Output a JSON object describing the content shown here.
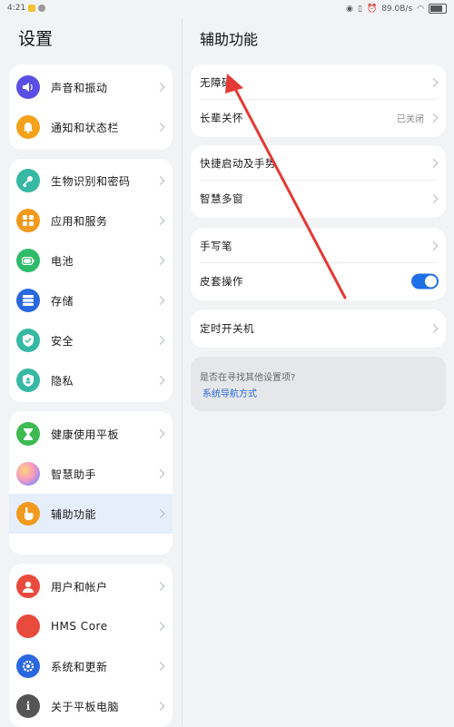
{
  "status_bar": {
    "time": "4:21",
    "speed": "89.0B/s",
    "battery": "89"
  },
  "left": {
    "title": "设置",
    "groups": [
      [
        {
          "label": "声音和振动",
          "icon": "sound-icon",
          "color": "#5a4fe3"
        },
        {
          "label": "通知和状态栏",
          "icon": "bell-icon",
          "color": "#f4a21b"
        }
      ],
      [
        {
          "label": "生物识别和密码",
          "icon": "key-icon",
          "color": "#35b8a4"
        },
        {
          "label": "应用和服务",
          "icon": "apps-icon",
          "color": "#f29a1e"
        },
        {
          "label": "电池",
          "icon": "battery-icon",
          "color": "#2fbb6a"
        },
        {
          "label": "存储",
          "icon": "storage-icon",
          "color": "#2a68e0"
        },
        {
          "label": "安全",
          "icon": "shield-icon",
          "color": "#36b9a4"
        },
        {
          "label": "隐私",
          "icon": "privacy-icon",
          "color": "#36b9a4"
        }
      ],
      [
        {
          "label": "健康使用平板",
          "icon": "hourglass-icon",
          "color": "#3dba52"
        },
        {
          "label": "智慧助手",
          "icon": "assistant-icon",
          "color": "#c4a0f0"
        },
        {
          "label": "辅助功能",
          "icon": "hand-icon",
          "color": "#f29a1e",
          "active": true
        }
      ],
      [
        {
          "label": "用户和帐户",
          "icon": "user-icon",
          "color": "#e84a3d"
        },
        {
          "label": "HMS Core",
          "icon": "hms-icon",
          "color": "#e84a3d"
        },
        {
          "label": "系统和更新",
          "icon": "system-icon",
          "color": "#2a68e0"
        },
        {
          "label": "关于平板电脑",
          "icon": "info-icon",
          "color": "#555555"
        }
      ]
    ]
  },
  "right": {
    "title": "辅助功能",
    "cards": [
      [
        {
          "label": "无障碍"
        },
        {
          "label": "长辈关怀",
          "value": "已关闭"
        }
      ],
      [
        {
          "label": "快捷启动及手势"
        },
        {
          "label": "智慧多窗"
        }
      ],
      [
        {
          "label": "手写笔"
        },
        {
          "label": "皮套操作",
          "toggle": true
        }
      ],
      [
        {
          "label": "定时开关机"
        }
      ]
    ],
    "hint": {
      "question": "是否在寻找其他设置项?",
      "link": "系统导航方式"
    }
  },
  "accent_color": "#1f6fe6"
}
